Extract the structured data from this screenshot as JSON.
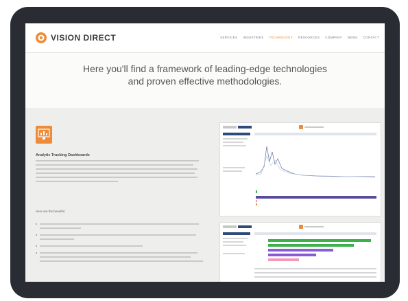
{
  "site": {
    "logo_text": "VISION DIRECT",
    "nav_items": [
      "SERVICES",
      "INDUSTRIES",
      "TECHNOLOGY",
      "RESOURCES",
      "COMPANY",
      "NEWS",
      "CONTACT"
    ],
    "active_nav": "TECHNOLOGY"
  },
  "hero": {
    "line1": "Here you'll find a framework of leading-edge technologies",
    "line2": "and proven effective methodologies."
  },
  "feature": {
    "title": "Analytic Tracking Dashboards",
    "icon": "dashboard-icon",
    "benefits_title": "Here are the benefits:"
  },
  "colors": {
    "accent": "#ed8b3a",
    "device_frame": "#2a2c33",
    "dashboard_navy": "#2c4a7a",
    "bar_green": "#3db04b",
    "bar_purple": "#8a5bd6",
    "bar_pink": "#f59ab5"
  }
}
